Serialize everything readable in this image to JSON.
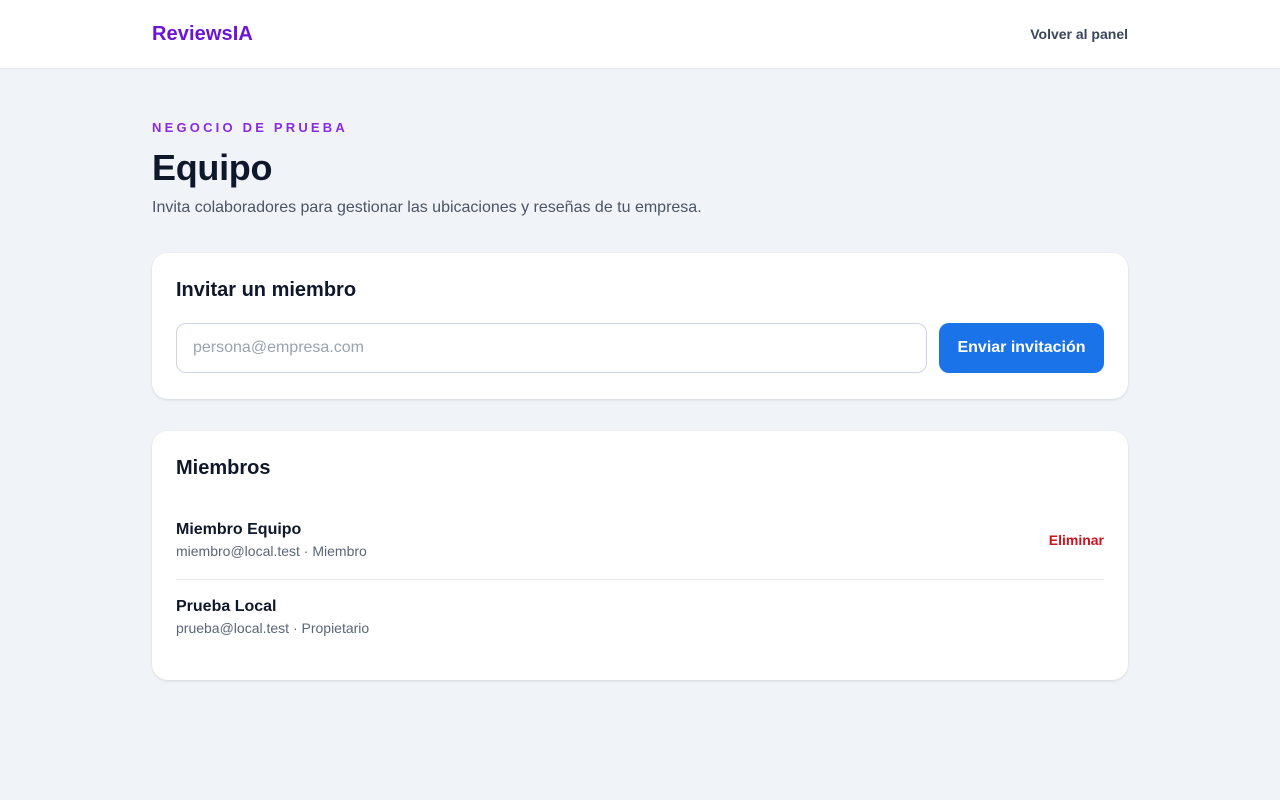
{
  "header": {
    "brand": "ReviewsIA",
    "back_link": "Volver al panel"
  },
  "page": {
    "eyebrow": "NEGOCIO DE PRUEBA",
    "title": "Equipo",
    "subtitle": "Invita colaboradores para gestionar las ubicaciones y reseñas de tu empresa."
  },
  "invite": {
    "title": "Invitar un miembro",
    "email_placeholder": "persona@empresa.com",
    "email_value": "",
    "send_label": "Enviar invitación"
  },
  "members": {
    "title": "Miembros",
    "items": [
      {
        "name": "Miembro Equipo",
        "meta": "miembro@local.test · Miembro",
        "remove_label": "Eliminar"
      },
      {
        "name": "Prueba Local",
        "meta": "prueba@local.test · Propietario"
      }
    ]
  },
  "colors": {
    "brand": "#6d14d4",
    "eyebrow": "#8a2be2",
    "primary_button": "#1a73e8",
    "danger": "#d0101e",
    "background": "#f0f3f8"
  }
}
